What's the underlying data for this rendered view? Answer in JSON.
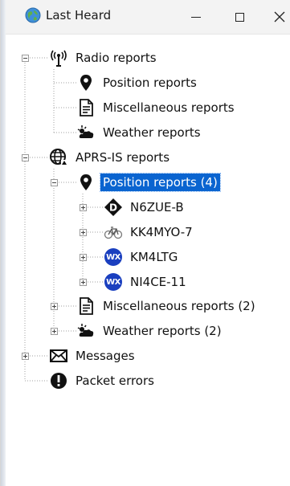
{
  "window": {
    "title": "Last Heard",
    "buttons": {
      "minimize": "—",
      "maximize": "□",
      "close": "✕"
    }
  },
  "tree": {
    "radio_reports": {
      "label": "Radio reports",
      "icon": "antenna-icon",
      "children": {
        "position": {
          "label": "Position reports",
          "icon": "map-pin-icon"
        },
        "misc": {
          "label": "Miscellaneous reports",
          "icon": "document-icon"
        },
        "weather": {
          "label": "Weather reports",
          "icon": "weather-icon"
        }
      }
    },
    "aprs_is_reports": {
      "label": "APRS-IS reports",
      "icon": "globe-icon",
      "children": {
        "position": {
          "label": "Position reports (4)",
          "icon": "map-pin-icon",
          "selected": true,
          "stations": [
            {
              "callsign": "N6ZUE-B",
              "icon": "d-star-diamond-icon"
            },
            {
              "callsign": "KK4MYO-7",
              "icon": "bicycle-icon"
            },
            {
              "callsign": "KM4LTG",
              "icon": "wx-station-icon",
              "badge": "WX"
            },
            {
              "callsign": "NI4CE-11",
              "icon": "wx-station-icon",
              "badge": "WX"
            }
          ]
        },
        "misc": {
          "label": "Miscellaneous reports (2)",
          "icon": "document-icon"
        },
        "weather": {
          "label": "Weather reports (2)",
          "icon": "weather-icon"
        }
      }
    },
    "messages": {
      "label": "Messages",
      "icon": "envelope-icon"
    },
    "packet_errors": {
      "label": "Packet errors",
      "icon": "error-icon"
    }
  },
  "colors": {
    "selection": "#0a64d0",
    "wx_badge": "#1a3fbf"
  }
}
